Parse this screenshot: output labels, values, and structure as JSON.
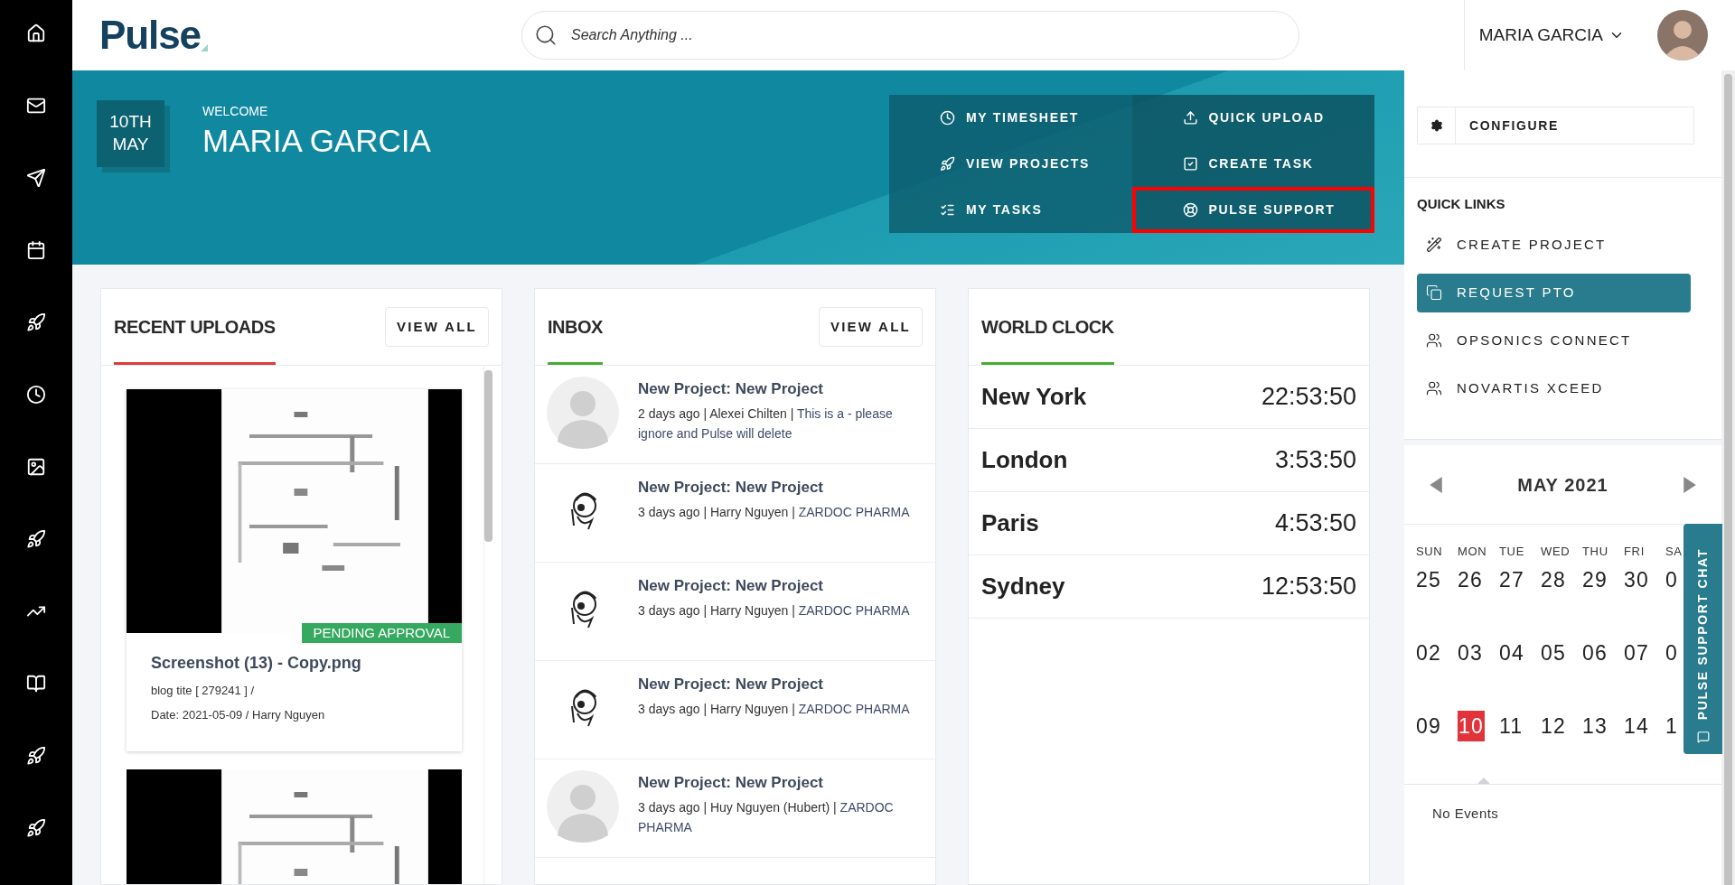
{
  "header": {
    "logo": "Pulse",
    "search": {
      "placeholder": "Search Anything ..."
    },
    "user": "MARIA GARCIA"
  },
  "hero": {
    "date": [
      "10TH",
      "MAY"
    ],
    "welcome": "WELCOME",
    "name": "MARIA GARCIA",
    "actions": [
      {
        "label": "MY TIMESHEET",
        "highlighted": false
      },
      {
        "label": "QUICK UPLOAD",
        "highlighted": false
      },
      {
        "label": "VIEW PROJECTS",
        "highlighted": false
      },
      {
        "label": "CREATE TASK",
        "highlighted": false
      },
      {
        "label": "MY TASKS",
        "highlighted": false
      },
      {
        "label": "PULSE SUPPORT",
        "highlighted": true
      }
    ]
  },
  "recent_uploads": {
    "title": "RECENT UPLOADS",
    "view_all": "VIEW ALL",
    "items": [
      {
        "kind": "upload",
        "status": "PENDING APPROVAL",
        "name": "Screenshot (13) - Copy.png",
        "lines": [
          "blog tite [ 279241 ] /",
          "Date: 2021-05-09 / Harry Nguyen"
        ]
      },
      {
        "kind": "picture"
      }
    ]
  },
  "inbox": {
    "title": "INBOX",
    "view_all": "VIEW ALL",
    "items": [
      {
        "kind": "placeholder",
        "title": "New Project: New Project",
        "meta": "2 days ago | Alexei Chilten |",
        "org": "This is a - please ignore and Pulse will delete"
      },
      {
        "kind": "sketch",
        "title": "New Project: New Project",
        "meta": "3 days ago | Harry Nguyen |",
        "org": "ZARDOC PHARMA"
      },
      {
        "kind": "sketch",
        "title": "New Project: New Project",
        "meta": "3 days ago | Harry Nguyen |",
        "org": "ZARDOC PHARMA"
      },
      {
        "kind": "sketch",
        "title": "New Project: New Project",
        "meta": "3 days ago | Harry Nguyen |",
        "org": "ZARDOC PHARMA"
      },
      {
        "kind": "placeholder",
        "title": "New Project: New Project",
        "meta": "3 days ago | Huy Nguyen (Hubert) |",
        "org": "ZARDOC PHARMA"
      }
    ]
  },
  "world_clock": {
    "title": "WORLD CLOCK",
    "rows": [
      {
        "city": "New York",
        "time": "22:53:50"
      },
      {
        "city": "London",
        "time": "3:53:50"
      },
      {
        "city": "Paris",
        "time": "4:53:50"
      },
      {
        "city": "Sydney",
        "time": "12:53:50"
      }
    ]
  },
  "side_panel": {
    "configure": "CONFIGURE",
    "quick_links_title": "QUICK LINKS",
    "quick_links": [
      {
        "label": "CREATE PROJECT",
        "selected": false
      },
      {
        "label": "REQUEST PTO",
        "selected": true
      },
      {
        "label": "OPSONICS CONNECT",
        "selected": false
      },
      {
        "label": "NOVARTIS XCEED",
        "selected": false
      }
    ],
    "calendar": {
      "month": "MAY 2021",
      "weekdays": [
        "SUN",
        "MON",
        "TUE",
        "WED",
        "THU",
        "FRI",
        "SA"
      ],
      "weeks": [
        [
          {
            "label": "25",
            "selected": false
          },
          {
            "label": "26",
            "selected": false
          },
          {
            "label": "27",
            "selected": false
          },
          {
            "label": "28",
            "selected": false
          },
          {
            "label": "29",
            "selected": false
          },
          {
            "label": "30",
            "selected": false
          },
          {
            "label": "0",
            "selected": false
          }
        ],
        [
          {
            "label": "02",
            "selected": false
          },
          {
            "label": "03",
            "selected": false
          },
          {
            "label": "04",
            "selected": false
          },
          {
            "label": "05",
            "selected": false
          },
          {
            "label": "06",
            "selected": false
          },
          {
            "label": "07",
            "selected": false
          },
          {
            "label": "0",
            "selected": false
          }
        ],
        [
          {
            "label": "09",
            "selected": false
          },
          {
            "label": "10",
            "selected": true
          },
          {
            "label": "11",
            "selected": false
          },
          {
            "label": "12",
            "selected": false
          },
          {
            "label": "13",
            "selected": false
          },
          {
            "label": "14",
            "selected": false
          },
          {
            "label": "1",
            "selected": false
          }
        ]
      ],
      "events": "No Events"
    }
  },
  "chat_tab": "PULSE SUPPORT CHAT"
}
